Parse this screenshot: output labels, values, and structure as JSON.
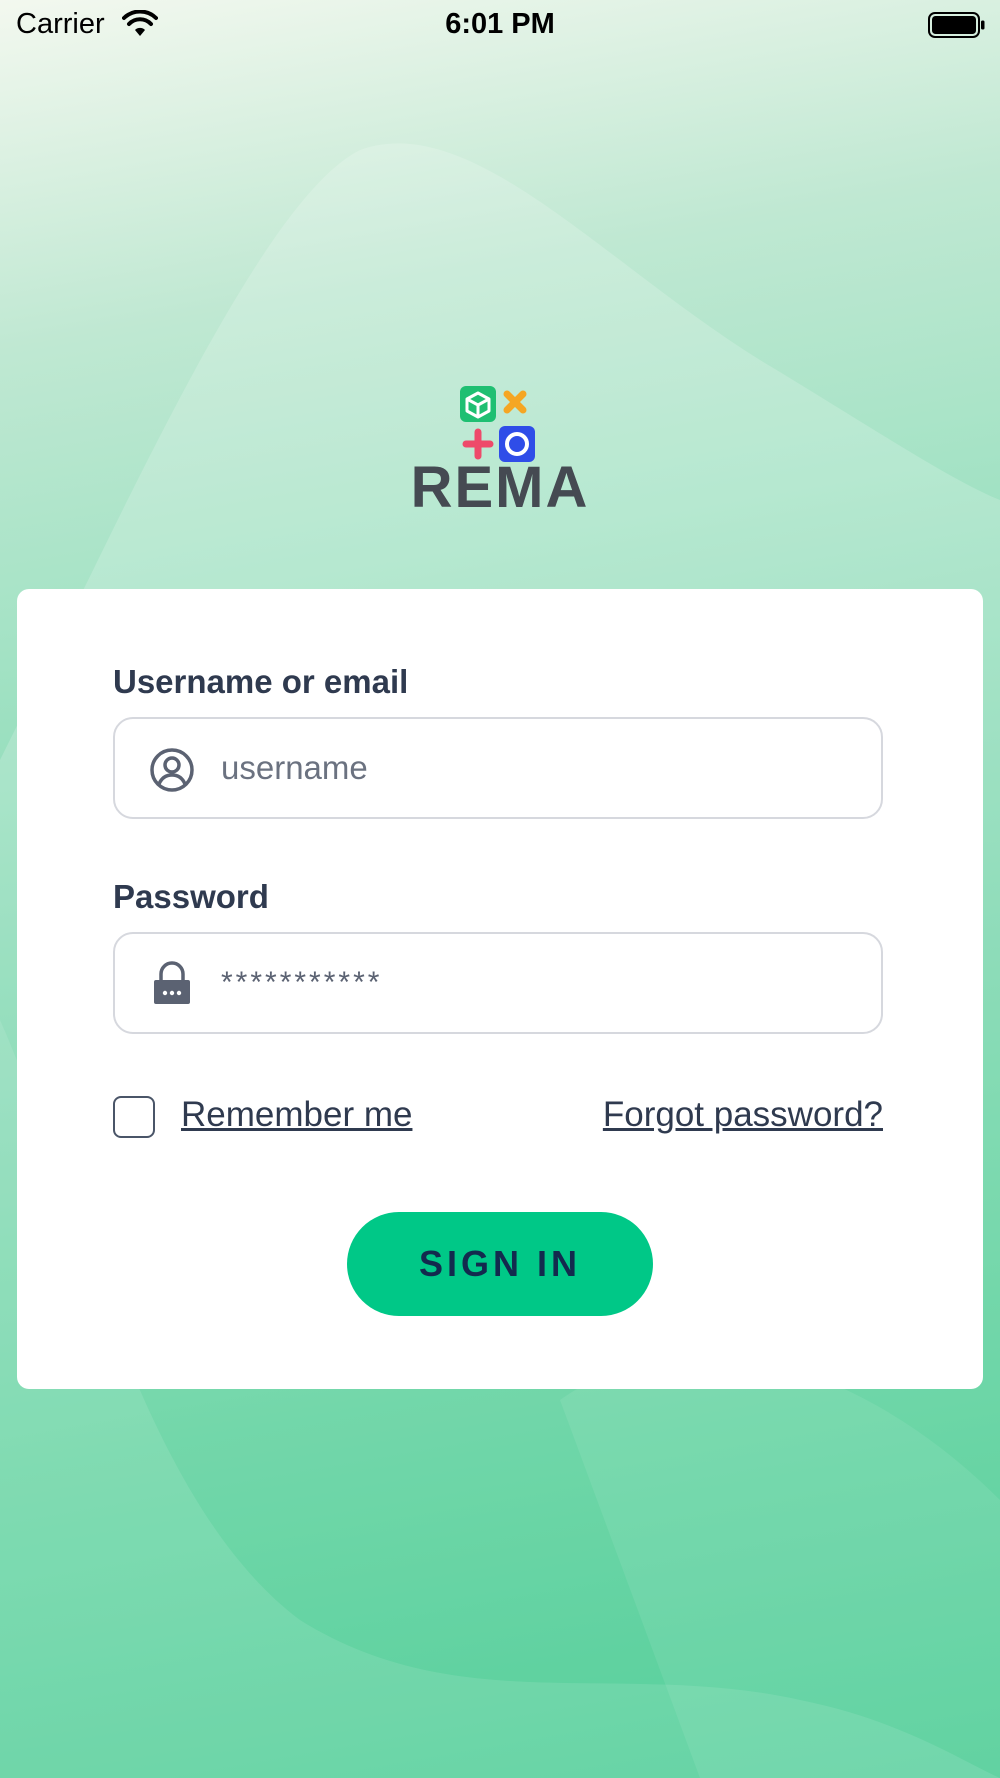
{
  "status_bar": {
    "carrier": "Carrier",
    "time": "6:01 PM",
    "icons": [
      "wifi-icon",
      "battery-icon"
    ]
  },
  "brand": {
    "name": "REMA",
    "logo_icon": "rema-logo-icon",
    "logo_colors": [
      "#1fbf72",
      "#f5a623",
      "#ee4a6a",
      "#2f4de8"
    ]
  },
  "login_form": {
    "username_label": "Username or email",
    "username_value": "username",
    "username_icon": "user-circle-icon",
    "password_label": "Password",
    "password_value": "***********",
    "password_icon": "lock-icon",
    "remember_label": "Remember me",
    "remember_checked": false,
    "forgot_label": "Forgot password?",
    "submit_label": "SIGN IN"
  },
  "colors": {
    "accent": "#00c887",
    "button_text": "#132a4e",
    "text": "#2f3a4f"
  }
}
